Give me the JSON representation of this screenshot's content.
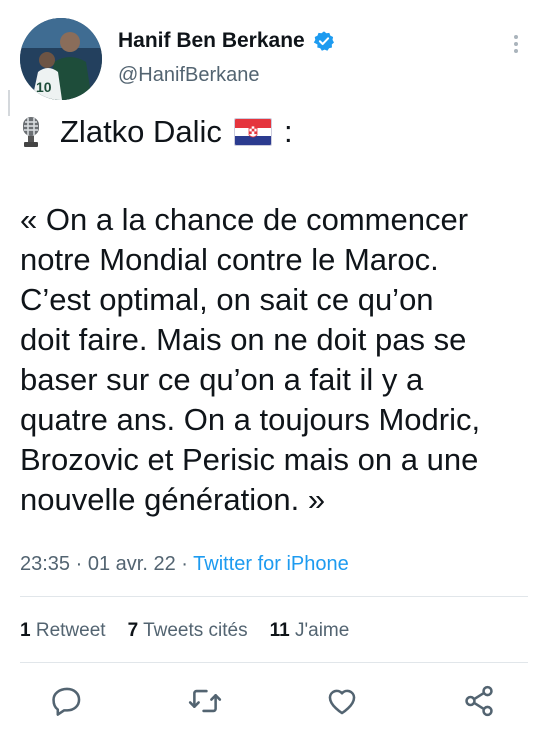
{
  "tweet": {
    "display_name": "Hanif Ben Berkane",
    "handle": "@HanifBerkane",
    "speaker_name": "Zlatko Dalic",
    "speaker_suffix": ":",
    "quote_lines": [
      "« On a la chance de commencer",
      "notre Mondial contre le Maroc.",
      "C’est optimal, on sait ce qu’on",
      "doit faire. Mais on ne doit pas se",
      "baser sur ce qu’on a fait il y a",
      "quatre ans. On a toujours Modric,",
      "Brozovic et Perisic mais on a une",
      "nouvelle génération. »"
    ],
    "time": "23:35",
    "date": "01 avr. 22",
    "source": "Twitter for iPhone",
    "separator": "·"
  },
  "stats": {
    "retweets_count": "1",
    "retweets_label": "Retweet",
    "quotes_count": "7",
    "quotes_label": "Tweets cités",
    "likes_count": "11",
    "likes_label": "J'aime"
  },
  "icons": {
    "verified": "verified-badge-icon",
    "more": "more-options-icon",
    "mic": "microphone-emoji-icon",
    "flag": "croatia-flag-icon",
    "reply": "reply-icon",
    "retweet": "retweet-icon",
    "like": "like-icon",
    "share": "share-icon"
  },
  "colors": {
    "accent": "#1d9bf0",
    "secondary_text": "#536471",
    "primary_text": "#0f1419"
  }
}
